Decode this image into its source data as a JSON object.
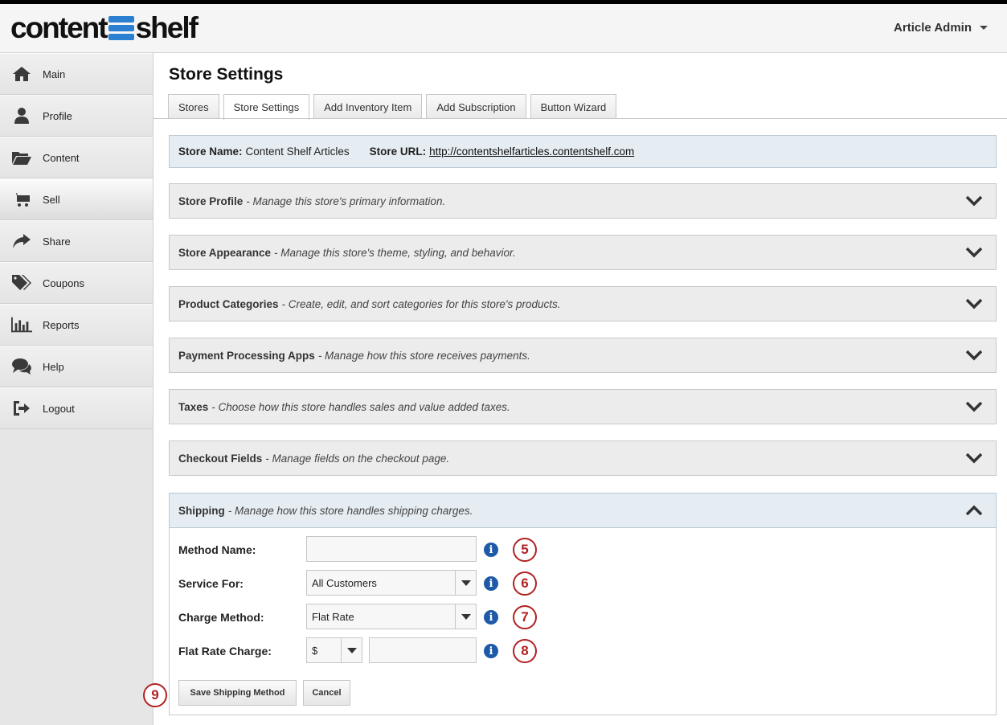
{
  "brand": {
    "logo_left": "content",
    "logo_right": "shelf"
  },
  "user_menu": {
    "label": "Article Admin"
  },
  "sidebar": {
    "items": [
      {
        "label": "Main",
        "icon": "home-icon"
      },
      {
        "label": "Profile",
        "icon": "user-icon"
      },
      {
        "label": "Content",
        "icon": "folder-icon"
      },
      {
        "label": "Sell",
        "icon": "cart-icon"
      },
      {
        "label": "Share",
        "icon": "share-icon"
      },
      {
        "label": "Coupons",
        "icon": "tags-icon"
      },
      {
        "label": "Reports",
        "icon": "bar-chart-icon"
      },
      {
        "label": "Help",
        "icon": "comments-icon"
      },
      {
        "label": "Logout",
        "icon": "logout-icon"
      }
    ],
    "active": "Sell"
  },
  "page": {
    "title": "Store Settings",
    "tabs": [
      "Stores",
      "Store Settings",
      "Add Inventory Item",
      "Add Subscription",
      "Button Wizard"
    ],
    "active_tab": "Store Settings"
  },
  "store_info": {
    "name_label": "Store Name:",
    "name_value": "Content Shelf Articles",
    "url_label": "Store URL:",
    "url_value": "http://contentshelfarticles.contentshelf.com"
  },
  "panels": [
    {
      "title": "Store Profile",
      "desc": "- Manage this store's primary information."
    },
    {
      "title": "Store Appearance",
      "desc": "- Manage this store's theme, styling, and behavior."
    },
    {
      "title": "Product Categories",
      "desc": "- Create, edit, and sort categories for this store's products."
    },
    {
      "title": "Payment Processing Apps",
      "desc": "- Manage how this store receives payments."
    },
    {
      "title": "Taxes",
      "desc": "- Choose how this store handles sales and value added taxes."
    },
    {
      "title": "Checkout Fields",
      "desc": "- Manage fields on the checkout page."
    },
    {
      "title": "Shipping",
      "desc": "- Manage how this store handles shipping charges."
    }
  ],
  "shipping_form": {
    "method_name": {
      "label": "Method Name:",
      "value": "",
      "callout": "5"
    },
    "service_for": {
      "label": "Service For:",
      "value": "All Customers",
      "callout": "6"
    },
    "charge_method": {
      "label": "Charge Method:",
      "value": "Flat Rate",
      "callout": "7"
    },
    "flat_rate_charge": {
      "label": "Flat Rate Charge:",
      "currency": "$",
      "value": "",
      "callout": "8"
    },
    "save_label": "Save Shipping Method",
    "cancel_label": "Cancel",
    "buttons_callout": "9"
  },
  "colors": {
    "info_icon": "#1f5aa8",
    "callout": "#b22222",
    "open_panel": "#e5edf2"
  }
}
